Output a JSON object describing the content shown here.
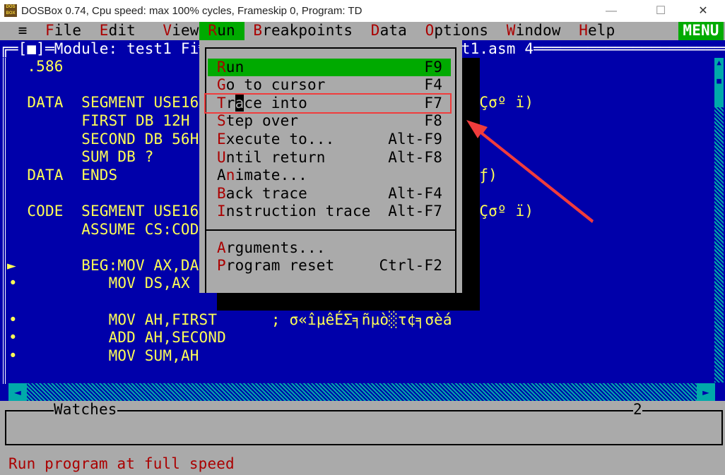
{
  "window": {
    "title": "DOSBox 0.74, Cpu speed: max 100% cycles, Frameskip  0, Program:      TD",
    "icon_text": "DOS BOX",
    "controls": [
      "minimize",
      "maximize",
      "close"
    ]
  },
  "menubar": {
    "system": "≡",
    "items": [
      {
        "label": "File",
        "col": 5
      },
      {
        "label": "Edit",
        "col": 11
      },
      {
        "label": "View",
        "col": 18
      },
      {
        "label": "Run",
        "col": 23,
        "active": true
      },
      {
        "label": "Breakpoints",
        "col": 28
      },
      {
        "label": "Data",
        "col": 41
      },
      {
        "label": "Options",
        "col": 47
      },
      {
        "label": "Window",
        "col": 56
      },
      {
        "label": "Help",
        "col": 64
      }
    ],
    "menu_button": "MENU"
  },
  "module_window": {
    "title_left": "╔═[■]═Module: test1 Fi",
    "title_right": "t1.asm 4═══════════════════════════1═[↑][↓]═╗",
    "title_shadow_fragment": "╗ñ"
  },
  "code_lines": [
    {
      "row": 2,
      "col": 3,
      "text": ".586"
    },
    {
      "row": 4,
      "col": 3,
      "text": "DATA  SEGMENT USE16"
    },
    {
      "row": 4,
      "col": 51,
      "text": "σ╝Çσº ï)",
      "shadow": "σ╝"
    },
    {
      "row": 5,
      "col": 9,
      "text": "FIRST DB 12H"
    },
    {
      "row": 6,
      "col": 9,
      "text": "SECOND DB 56H"
    },
    {
      "row": 7,
      "col": 9,
      "text": "SUM DB ?"
    },
    {
      "row": 8,
      "col": 3,
      "text": "DATA  ENDS"
    },
    {
      "row": 8,
      "col": 51,
      "text": "µ¥ƒ)"
    },
    {
      "row": 10,
      "col": 3,
      "text": "CODE  SEGMENT USE16"
    },
    {
      "row": 10,
      "col": 51,
      "text": "σ╝Çσº ï)"
    },
    {
      "row": 11,
      "col": 9,
      "text": "ASSUME CS:COD"
    },
    {
      "row": 13,
      "col": 9,
      "text": "BEG:MOV AX,DA"
    },
    {
      "row": 14,
      "col": 12,
      "text": "MOV DS,AX"
    },
    {
      "row": 16,
      "col": 12,
      "text": "MOV AH,FIRST      ; σ«îµêÉΣ╕ñµò░τ¢╕σèá"
    },
    {
      "row": 17,
      "col": 12,
      "text": "ADD AH,SECOND"
    },
    {
      "row": 18,
      "col": 12,
      "text": "MOV SUM,AH"
    }
  ],
  "markers": [
    {
      "row": 13,
      "symbol": "►"
    },
    {
      "row": 14,
      "symbol": "•"
    },
    {
      "row": 16,
      "symbol": "•"
    },
    {
      "row": 17,
      "symbol": "•"
    },
    {
      "row": 18,
      "symbol": "•"
    }
  ],
  "run_menu": {
    "items": [
      {
        "label": "Run",
        "hotkey": 0,
        "shortcut": "F9",
        "selected": true
      },
      {
        "label": "Go to cursor",
        "hotkey": 0,
        "shortcut": "F4"
      },
      {
        "label": "Trace into",
        "hotkey": 0,
        "shortcut": "F7",
        "cursor": 2
      },
      {
        "label": "Step over",
        "hotkey": 0,
        "shortcut": "F8"
      },
      {
        "label": "Execute to...",
        "hotkey": 0,
        "shortcut": "Alt-F9"
      },
      {
        "label": "Until return",
        "hotkey": 0,
        "shortcut": "Alt-F8"
      },
      {
        "label": "Animate...",
        "hotkey": 1,
        "shortcut": ""
      },
      {
        "label": "Back trace",
        "hotkey": 0,
        "shortcut": "Alt-F4"
      },
      {
        "label": "Instruction trace",
        "hotkey": 0,
        "shortcut": "Alt-F7"
      },
      {
        "separator": true
      },
      {
        "label": "Arguments...",
        "hotkey": 0,
        "shortcut": ""
      },
      {
        "label": "Program reset",
        "hotkey": 0,
        "shortcut": "Ctrl-F2"
      }
    ]
  },
  "watches": {
    "title": "Watches",
    "number": "2"
  },
  "status": "Run program at full speed",
  "annotation": {
    "color": "#f03c3c",
    "highlighted_item": "Trace into"
  },
  "colors": {
    "desktop": "#0000aa",
    "menu": "#aaaaaa",
    "highlight": "#00aa00",
    "hotkey": "#aa0000",
    "code": "#ffff55"
  }
}
